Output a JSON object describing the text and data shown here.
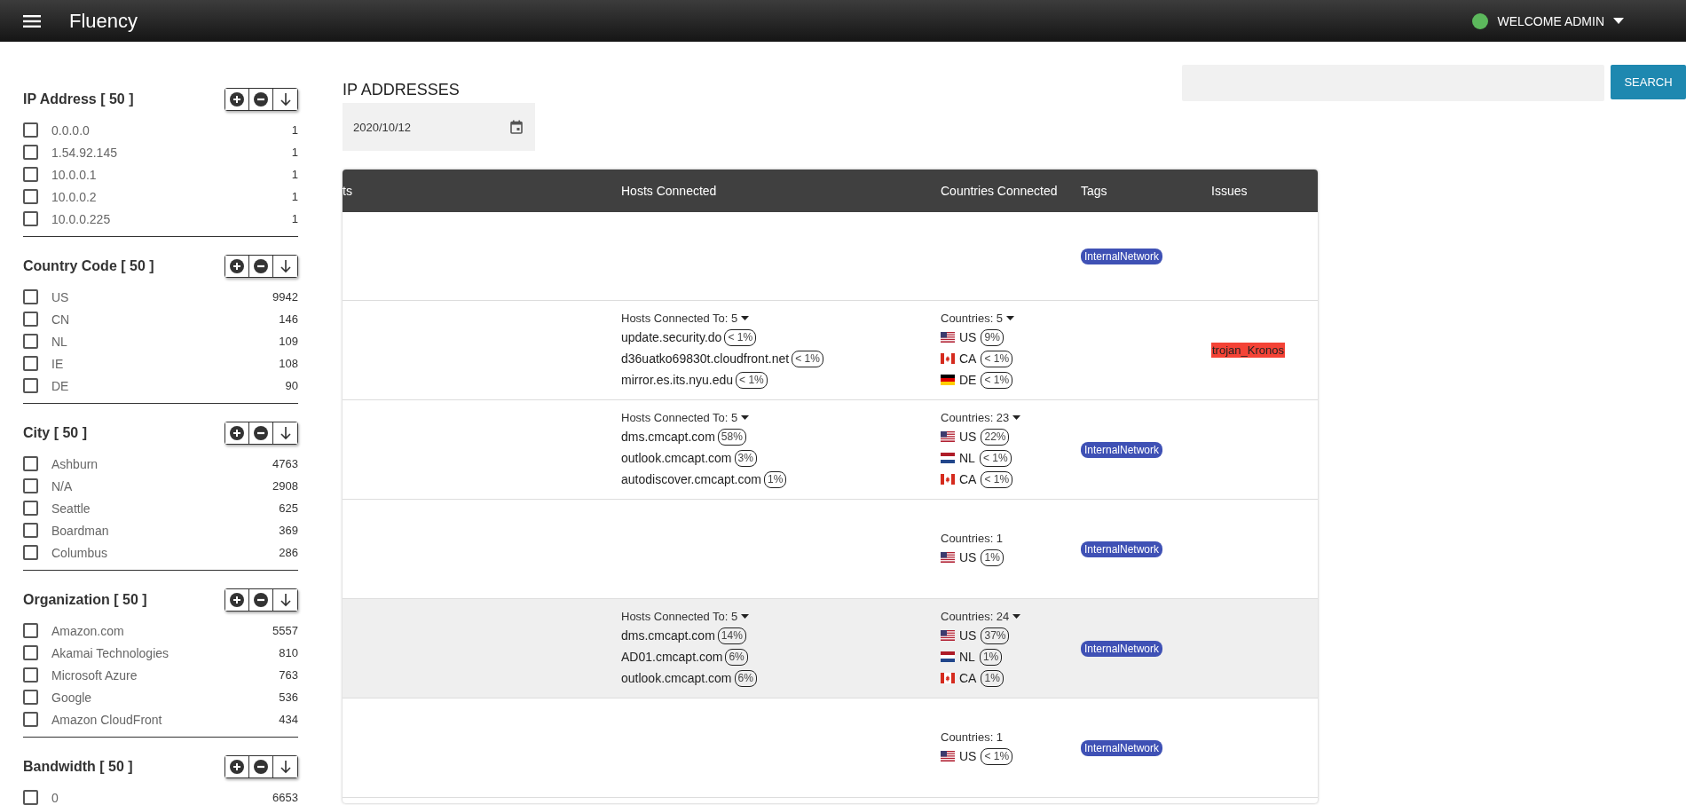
{
  "header": {
    "title": "Fluency",
    "user": "WELCOME ADMIN"
  },
  "filters": [
    {
      "title": "IP Address [ 50 ]",
      "items": [
        {
          "label": "0.0.0.0",
          "count": "1",
          "checked": false
        },
        {
          "label": "1.54.92.145",
          "count": "1",
          "checked": false
        },
        {
          "label": "10.0.0.1",
          "count": "1",
          "checked": false
        },
        {
          "label": "10.0.0.2",
          "count": "1",
          "checked": false
        },
        {
          "label": "10.0.0.225",
          "count": "1",
          "checked": false
        }
      ]
    },
    {
      "title": "Country Code [ 50 ]",
      "items": [
        {
          "label": "US",
          "count": "9942",
          "checked": false
        },
        {
          "label": "CN",
          "count": "146",
          "checked": false
        },
        {
          "label": "NL",
          "count": "109",
          "checked": false
        },
        {
          "label": "IE",
          "count": "108",
          "checked": false
        },
        {
          "label": "DE",
          "count": "90",
          "checked": false
        }
      ]
    },
    {
      "title": "City [ 50 ]",
      "items": [
        {
          "label": "Ashburn",
          "count": "4763",
          "checked": false
        },
        {
          "label": "N/A",
          "count": "2908",
          "checked": false
        },
        {
          "label": "Seattle",
          "count": "625",
          "checked": false
        },
        {
          "label": "Boardman",
          "count": "369",
          "checked": false
        },
        {
          "label": "Columbus",
          "count": "286",
          "checked": false
        }
      ]
    },
    {
      "title": "Organization [ 50 ]",
      "items": [
        {
          "label": "Amazon.com",
          "count": "5557",
          "checked": false
        },
        {
          "label": "Akamai Technologies",
          "count": "810",
          "checked": false
        },
        {
          "label": "Microsoft Azure",
          "count": "763",
          "checked": false
        },
        {
          "label": "Google",
          "count": "536",
          "checked": false
        },
        {
          "label": "Amazon CloudFront",
          "count": "434",
          "checked": false
        }
      ]
    },
    {
      "title": "Bandwidth [ 50 ]",
      "items": [
        {
          "label": "0",
          "count": "6653",
          "checked": false
        }
      ]
    }
  ],
  "main": {
    "title": "IP ADDRESSES",
    "date": "2020/10/12",
    "search": {
      "button": "SEARCH"
    }
  },
  "table": {
    "columns": [
      "ts",
      "Hosts Connected",
      "Countries Connected",
      "Tags",
      "Issues"
    ],
    "rows": [
      {
        "highlighted": false,
        "tags": [
          "InternalNetwork"
        ],
        "issues": []
      },
      {
        "highlighted": false,
        "hosts": {
          "summary": "Hosts Connected To: 5",
          "items": [
            {
              "name": "update.security.do",
              "share": "< 1%"
            },
            {
              "name": "d36uatko69830t.cloudfront.net",
              "share": "< 1%"
            },
            {
              "name": "mirror.es.its.nyu.edu",
              "share": "< 1%"
            }
          ]
        },
        "countries": {
          "summary": "Countries: 5",
          "expandable": true,
          "items": [
            {
              "kind": "us",
              "code": "US",
              "share": "9%"
            },
            {
              "kind": "ca",
              "code": "CA",
              "share": "< 1%"
            },
            {
              "kind": "de",
              "code": "DE",
              "share": "< 1%"
            }
          ]
        },
        "tags": [],
        "issues": [
          "trojan_Kronos"
        ]
      },
      {
        "highlighted": false,
        "hosts": {
          "summary": "Hosts Connected To: 5",
          "items": [
            {
              "name": "dms.cmcapt.com",
              "share": "58%"
            },
            {
              "name": "outlook.cmcapt.com",
              "share": "3%"
            },
            {
              "name": "autodiscover.cmcapt.com",
              "share": "1%"
            }
          ]
        },
        "countries": {
          "summary": "Countries: 23",
          "expandable": true,
          "items": [
            {
              "kind": "us",
              "code": "US",
              "share": "22%"
            },
            {
              "kind": "nl",
              "code": "NL",
              "share": "< 1%"
            },
            {
              "kind": "ca",
              "code": "CA",
              "share": "< 1%"
            }
          ]
        },
        "tags": [
          "InternalNetwork"
        ],
        "issues": []
      },
      {
        "highlighted": false,
        "countries": {
          "summary": "Countries: 1",
          "expandable": false,
          "items": [
            {
              "kind": "us",
              "code": "US",
              "share": "1%"
            }
          ]
        },
        "tags": [
          "InternalNetwork"
        ],
        "issues": []
      },
      {
        "highlighted": true,
        "hosts": {
          "summary": "Hosts Connected To: 5",
          "items": [
            {
              "name": "dms.cmcapt.com",
              "share": "14%"
            },
            {
              "name": "AD01.cmcapt.com",
              "share": "6%"
            },
            {
              "name": "outlook.cmcapt.com",
              "share": "6%"
            }
          ]
        },
        "countries": {
          "summary": "Countries: 24",
          "expandable": true,
          "items": [
            {
              "kind": "us",
              "code": "US",
              "share": "37%"
            },
            {
              "kind": "nl",
              "code": "NL",
              "share": "1%"
            },
            {
              "kind": "ca",
              "code": "CA",
              "share": "1%"
            }
          ]
        },
        "tags": [
          "InternalNetwork"
        ],
        "issues": []
      },
      {
        "highlighted": false,
        "countries": {
          "summary": "Countries: 1",
          "expandable": false,
          "items": [
            {
              "kind": "us",
              "code": "US",
              "share": "< 1%"
            }
          ]
        },
        "tags": [
          "InternalNetwork"
        ],
        "issues": []
      }
    ]
  }
}
